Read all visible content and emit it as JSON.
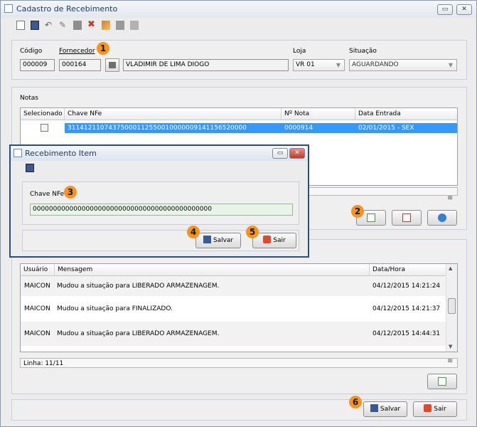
{
  "main_window": {
    "title": "Cadastro de Recebimento",
    "controls": [
      "▭",
      "✕"
    ]
  },
  "form": {
    "codigo_label": "Código",
    "codigo_value": "000009",
    "fornecedor_label": "Fornecedor",
    "fornecedor_code": "000164",
    "fornecedor_name": "VLADIMIR DE LIMA DIOGO",
    "loja_label": "Loja",
    "loja_value": "VR 01",
    "situacao_label": "Situação",
    "situacao_value": "AGUARDANDO"
  },
  "notas": {
    "section_label": "Notas",
    "columns": [
      "Selecionado",
      "Chave NFe",
      "Nº Nota",
      "Data Entrada"
    ],
    "rows": [
      {
        "chave": "31141211074375000112550010000009141156520000",
        "numero": "0000914",
        "data": "02/01/2015 - SEX"
      }
    ]
  },
  "log": {
    "columns": [
      "Usuário",
      "Mensagem",
      "Data/Hora"
    ],
    "rows": [
      {
        "usuario": "MAICON",
        "mensagem": "Mudou a situação para LIBERADO ARMAZENAGEM.",
        "datahora": "04/12/2015 14:21:24"
      },
      {
        "usuario": "MAICON",
        "mensagem": "Mudou a situação para FINALIZADO.",
        "datahora": "04/12/2015 14:21:37"
      },
      {
        "usuario": "MAICON",
        "mensagem": "Mudou a situação para LIBERADO ARMAZENAGEM.",
        "datahora": "04/12/2015 14:44:31"
      }
    ],
    "status": "Linha: 11/11"
  },
  "footer": {
    "salvar": "Salvar",
    "sair": "Sair"
  },
  "dialog": {
    "title": "Recebimento Item",
    "controls": [
      "▭",
      "✕"
    ],
    "chave_label": "Chave NFe",
    "chave_value": "00000000000000000000000000000000000000000000",
    "salvar": "Salvar",
    "sair": "Sair"
  },
  "badges": [
    "1",
    "2",
    "3",
    "4",
    "5",
    "6"
  ],
  "colors": {
    "selection": "#3399ff",
    "badge": "#f79321",
    "dialog_border": "#2a4d8a",
    "field_highlight": "#e8f4e8"
  }
}
